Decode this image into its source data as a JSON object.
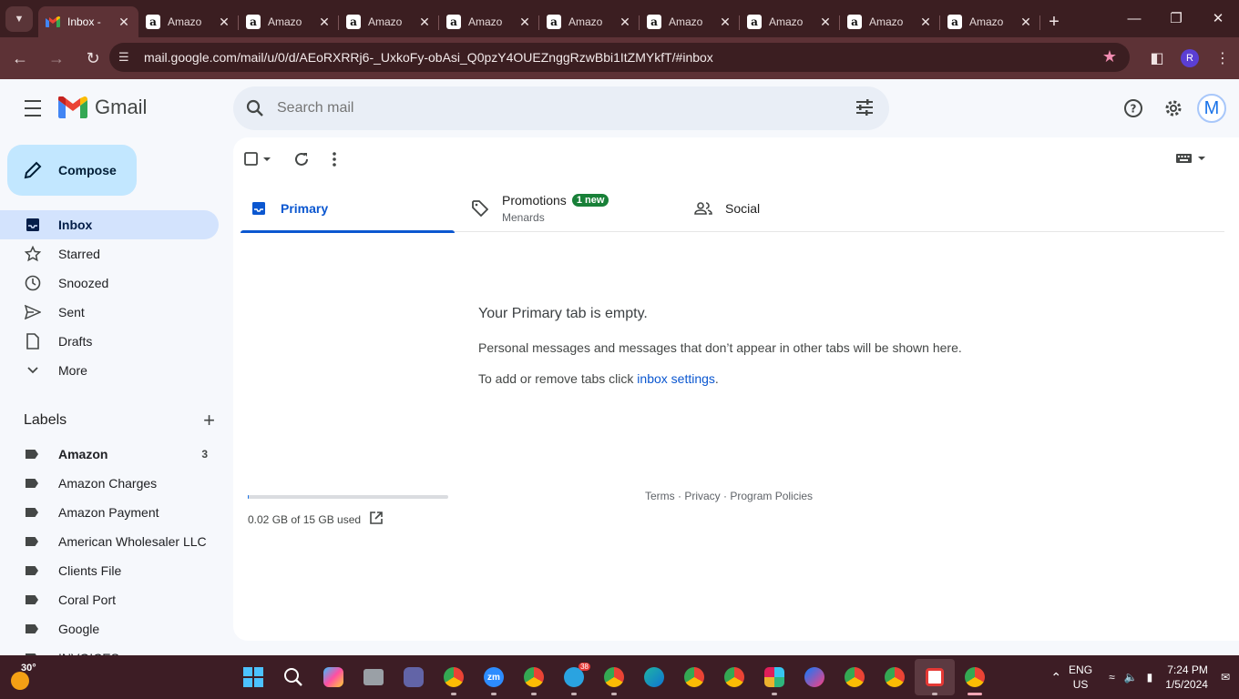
{
  "browser": {
    "tabs": [
      {
        "title": "Inbox -",
        "type": "gmail",
        "active": true
      },
      {
        "title": "Amazo",
        "type": "amazon"
      },
      {
        "title": "Amazo",
        "type": "amazon"
      },
      {
        "title": "Amazo",
        "type": "amazon"
      },
      {
        "title": "Amazo",
        "type": "amazon"
      },
      {
        "title": "Amazo",
        "type": "amazon"
      },
      {
        "title": "Amazo",
        "type": "amazon"
      },
      {
        "title": "Amazo",
        "type": "amazon"
      },
      {
        "title": "Amazo",
        "type": "amazon"
      },
      {
        "title": "Amazo",
        "type": "amazon"
      }
    ],
    "url": "mail.google.com/mail/u/0/d/AEoRXRRj6-_UxkoFy-obAsi_Q0pzY4OUEZnggRzwBbi1ItZMYkfT/#inbox",
    "profile_initial": "R",
    "accent": "#5d3236"
  },
  "gmail": {
    "logo_text": "Gmail",
    "search_placeholder": "Search mail",
    "account_initial": "M",
    "compose_label": "Compose",
    "nav": [
      {
        "label": "Inbox",
        "icon": "inbox-icon",
        "active": true
      },
      {
        "label": "Starred",
        "icon": "star-icon"
      },
      {
        "label": "Snoozed",
        "icon": "clock-icon"
      },
      {
        "label": "Sent",
        "icon": "send-icon"
      },
      {
        "label": "Drafts",
        "icon": "draft-icon"
      },
      {
        "label": "More",
        "icon": "chevron-down-icon"
      }
    ],
    "labels_title": "Labels",
    "labels": [
      {
        "name": "Amazon",
        "count": "3",
        "bold": true
      },
      {
        "name": "Amazon Charges"
      },
      {
        "name": "Amazon Payment"
      },
      {
        "name": "American Wholesaler LLC"
      },
      {
        "name": "Clients File"
      },
      {
        "name": "Coral Port"
      },
      {
        "name": "Google"
      },
      {
        "name": "INVOICES"
      }
    ],
    "tabs": {
      "primary": "Primary",
      "promotions": "Promotions",
      "promotions_badge": "1 new",
      "promotions_sub": "Menards",
      "social": "Social"
    },
    "empty": {
      "heading": "Your Primary tab is empty.",
      "line1": "Personal messages and messages that don’t appear in other tabs will be shown here.",
      "line2_prefix": "To add or remove tabs click ",
      "line2_link": "inbox settings",
      "line2_suffix": "."
    },
    "storage": {
      "text": "0.02 GB of 15 GB used",
      "fraction": 0.0013
    },
    "footer": {
      "terms": "Terms",
      "privacy": "Privacy",
      "policies": "Program Policies",
      "sep": " · "
    }
  },
  "taskbar": {
    "weather_temp": "30°",
    "telegram_badge": "38",
    "lang_top": "ENG",
    "lang_bottom": "US",
    "time": "7:24 PM",
    "date": "1/5/2024"
  }
}
